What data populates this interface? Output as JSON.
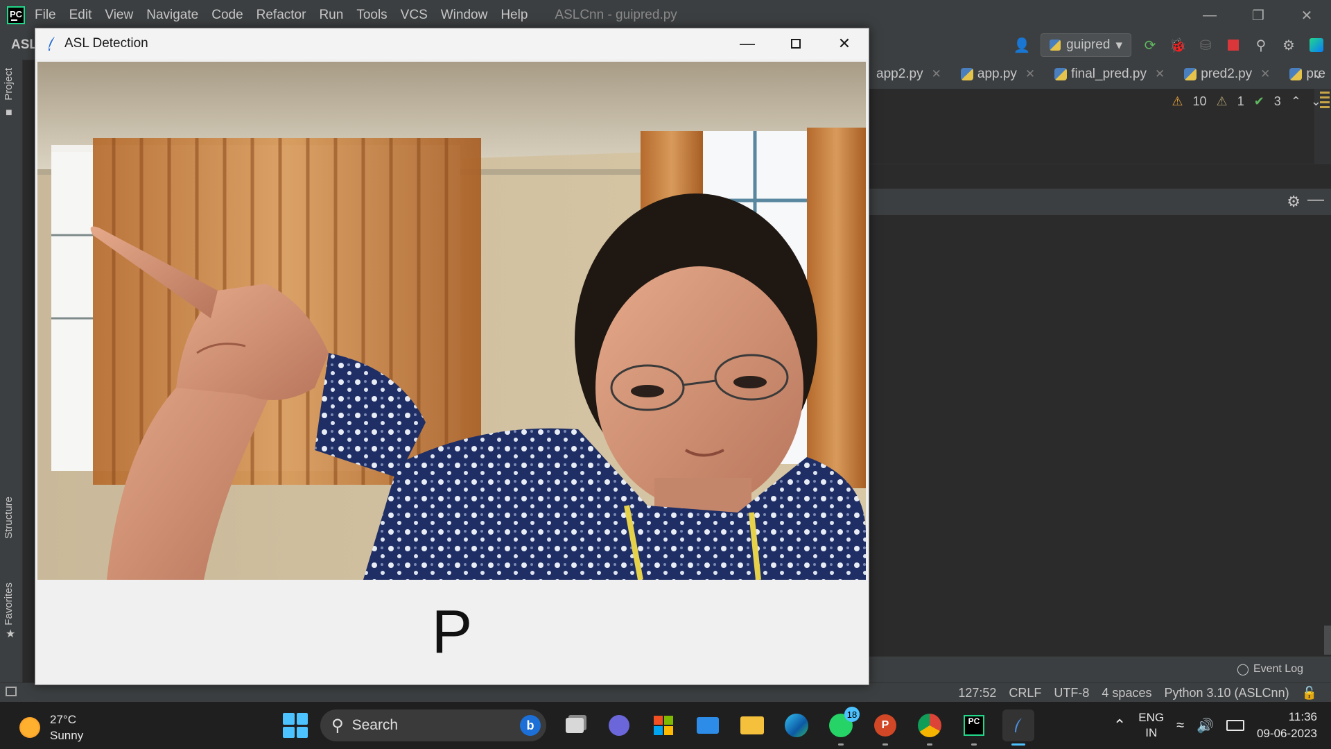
{
  "ide": {
    "menu": [
      "File",
      "Edit",
      "View",
      "Navigate",
      "Code",
      "Refactor",
      "Run",
      "Tools",
      "VCS",
      "Window",
      "Help"
    ],
    "window_title": "ASLCnn - guipred.py",
    "project_name": "ASL",
    "run_config": "guipred",
    "tabs": [
      {
        "label": "app2.py"
      },
      {
        "label": "app.py"
      },
      {
        "label": "final_pred.py"
      },
      {
        "label": "pred2.py"
      },
      {
        "label": "pre"
      }
    ],
    "inspections": {
      "warnings": "10",
      "weak_warnings": "1",
      "ok": "3"
    },
    "left_tabs": {
      "project": "Project",
      "structure": "Structure",
      "favorites": "Favorites"
    },
    "event_log": "Event Log",
    "status": {
      "position": "127:52",
      "line_sep": "CRLF",
      "encoding": "UTF-8",
      "indent": "4 spaces",
      "interpreter": "Python 3.10 (ASLCnn)"
    }
  },
  "asl_window": {
    "title": "ASL Detection",
    "prediction": "P"
  },
  "taskbar": {
    "weather_temp": "27°C",
    "weather_desc": "Sunny",
    "search_placeholder": "Search",
    "whatsapp_badge": "18",
    "lang_top": "ENG",
    "lang_bottom": "IN",
    "time": "11:36",
    "date": "09-06-2023"
  },
  "colors": {
    "ide_bg": "#2b2b2b",
    "ide_panel": "#3c3f41",
    "accent_blue": "#4cc2ff",
    "warning": "#e8a33d"
  }
}
